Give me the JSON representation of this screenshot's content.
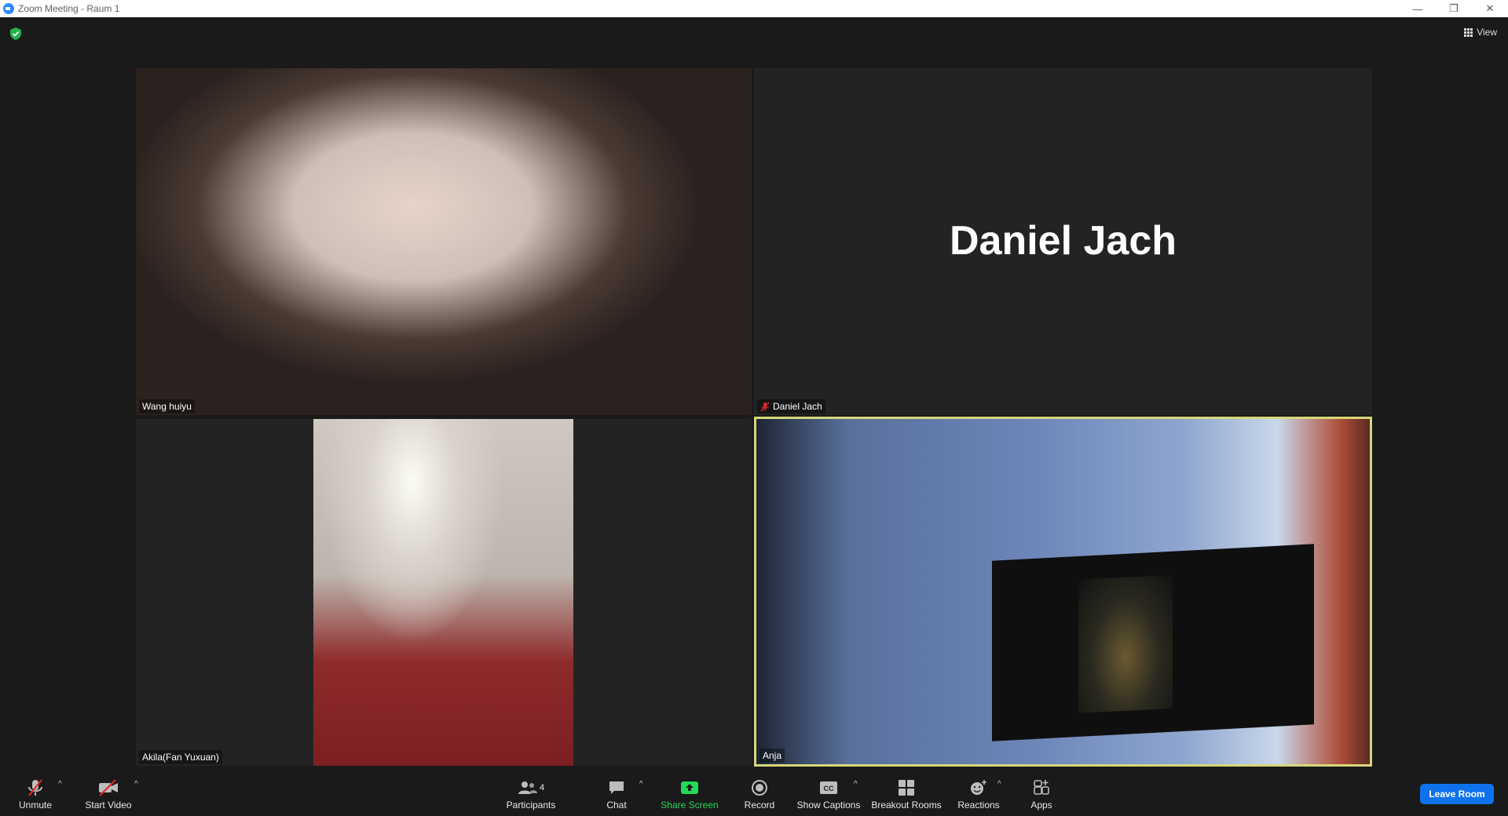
{
  "window": {
    "title": "Zoom Meeting - Raum 1",
    "minimize": "—",
    "restore": "❐",
    "close": "✕"
  },
  "header": {
    "view_label": "View"
  },
  "tiles": {
    "wang": {
      "name": "Wang huiyu"
    },
    "daniel": {
      "name": "Daniel Jach",
      "display_name": "Daniel Jach"
    },
    "akila": {
      "name": "Akila(Fan Yuxuan)"
    },
    "anja": {
      "name": "Anja"
    }
  },
  "toolbar": {
    "unmute": "Unmute",
    "start_video": "Start Video",
    "participants": "Participants",
    "participants_count": "4",
    "chat": "Chat",
    "share_screen": "Share Screen",
    "record": "Record",
    "show_captions": "Show Captions",
    "breakout_rooms": "Breakout Rooms",
    "reactions": "Reactions",
    "apps": "Apps",
    "leave": "Leave Room"
  },
  "colors": {
    "share_green": "#23d959",
    "leave_blue": "#0e72ed",
    "active_speaker_border": "#d6d77a",
    "muted_red": "#e02828"
  }
}
